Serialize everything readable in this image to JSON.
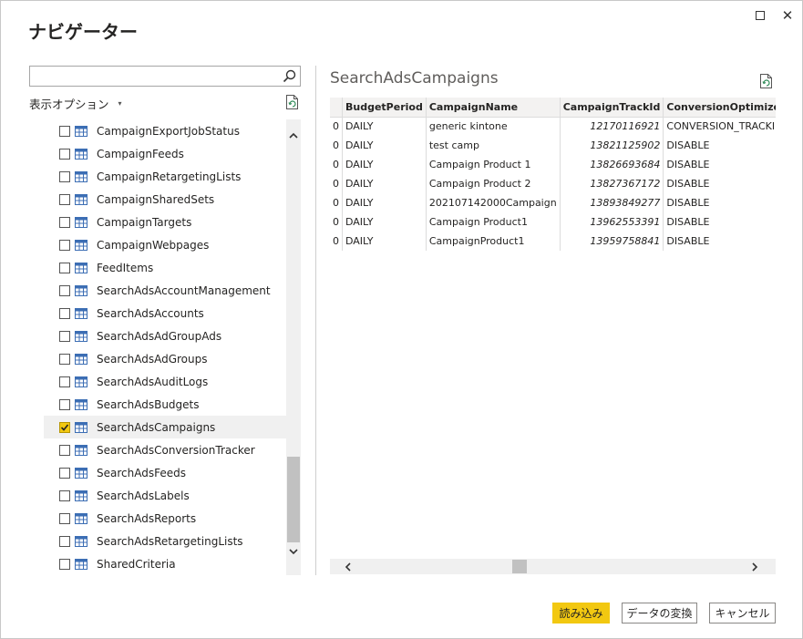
{
  "window": {
    "title": "ナビゲーター",
    "maximize_icon": "maximize-icon",
    "close_icon": "close-icon",
    "close_glyph": "✕"
  },
  "left": {
    "search": {
      "value": "",
      "placeholder": ""
    },
    "options_label": "表示オプション",
    "options_caret": "▾",
    "items": [
      {
        "label": "CampaignExportJobStatus",
        "checked": false
      },
      {
        "label": "CampaignFeeds",
        "checked": false
      },
      {
        "label": "CampaignRetargetingLists",
        "checked": false
      },
      {
        "label": "CampaignSharedSets",
        "checked": false
      },
      {
        "label": "CampaignTargets",
        "checked": false
      },
      {
        "label": "CampaignWebpages",
        "checked": false
      },
      {
        "label": "FeedItems",
        "checked": false
      },
      {
        "label": "SearchAdsAccountManagement",
        "checked": false
      },
      {
        "label": "SearchAdsAccounts",
        "checked": false
      },
      {
        "label": "SearchAdsAdGroupAds",
        "checked": false
      },
      {
        "label": "SearchAdsAdGroups",
        "checked": false
      },
      {
        "label": "SearchAdsAuditLogs",
        "checked": false
      },
      {
        "label": "SearchAdsBudgets",
        "checked": false
      },
      {
        "label": "SearchAdsCampaigns",
        "checked": true
      },
      {
        "label": "SearchAdsConversionTracker",
        "checked": false
      },
      {
        "label": "SearchAdsFeeds",
        "checked": false
      },
      {
        "label": "SearchAdsLabels",
        "checked": false
      },
      {
        "label": "SearchAdsReports",
        "checked": false
      },
      {
        "label": "SearchAdsRetargetingLists",
        "checked": false
      },
      {
        "label": "SharedCriteria",
        "checked": false
      }
    ]
  },
  "preview": {
    "title": "SearchAdsCampaigns",
    "columns": [
      "",
      "BudgetPeriod",
      "CampaignName",
      "CampaignTrackId",
      "ConversionOptimizerEligi"
    ],
    "rows": [
      [
        "0",
        "DAILY",
        "generic kintone",
        "12170116921",
        "CONVERSION_TRACKING_"
      ],
      [
        "0",
        "DAILY",
        "test camp",
        "13821125902",
        "DISABLE"
      ],
      [
        "0",
        "DAILY",
        "Campaign Product 1",
        "13826693684",
        "DISABLE"
      ],
      [
        "0",
        "DAILY",
        "Campaign Product 2",
        "13827367172",
        "DISABLE"
      ],
      [
        "0",
        "DAILY",
        "202107142000Campaign",
        "13893849277",
        "DISABLE"
      ],
      [
        "0",
        "DAILY",
        "Campaign Product1",
        "13962553391",
        "DISABLE"
      ],
      [
        "0",
        "DAILY",
        "CampaignProduct1",
        "13959758841",
        "DISABLE"
      ]
    ]
  },
  "buttons": {
    "load": "読み込み",
    "transform": "データの変換",
    "cancel": "キャンセル"
  },
  "colors": {
    "accent": "#f2c811",
    "text": "#252423"
  }
}
